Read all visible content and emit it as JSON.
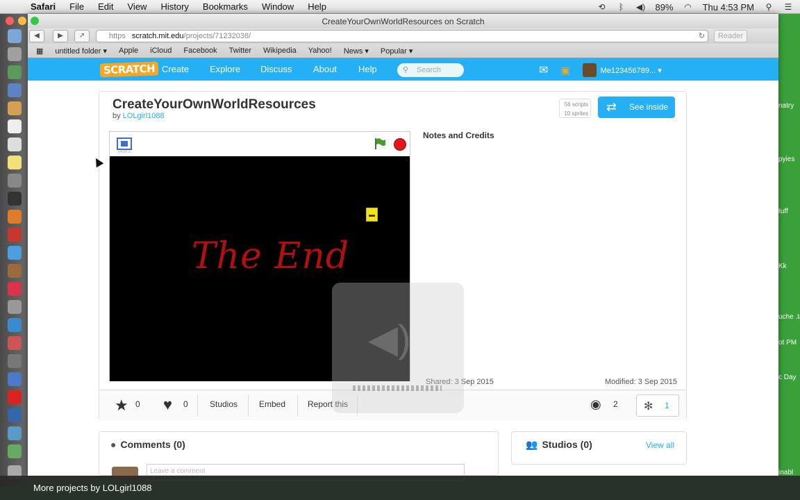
{
  "menubar": {
    "app": "Safari",
    "items": [
      "File",
      "Edit",
      "View",
      "History",
      "Bookmarks",
      "Window",
      "Help"
    ],
    "battery": "89%",
    "clock": "Thu 4:53 PM"
  },
  "window": {
    "title": "CreateYourOwnWorldResources on Scratch",
    "url_scheme": "https",
    "url_host": "scratch.mit.edu",
    "url_path": "/projects/71232038/",
    "reader": "Reader"
  },
  "bookmarks": [
    "untitled folder ▾",
    "Apple",
    "iCloud",
    "Facebook",
    "Twitter",
    "Wikipedia",
    "Yahoo!",
    "News ▾",
    "Popular ▾"
  ],
  "scratch_nav": {
    "logo": "SCRATCH",
    "links": [
      "Create",
      "Explore",
      "Discuss",
      "About",
      "Help"
    ],
    "search_placeholder": "Search",
    "user": "Me123456789... ▾"
  },
  "project": {
    "title": "CreateYourOwnWorldResources",
    "by": "by",
    "author": "LOLgirl1088",
    "scripts": "56 scripts",
    "sprites": "10 sprites",
    "see_inside": "See inside",
    "version": "v439.2",
    "stage_text": "The End",
    "notes_heading": "Notes and Credits",
    "shared": "Shared: 3 Sep 2015",
    "modified": "Modified: 3 Sep 2015"
  },
  "actions": {
    "stars": "0",
    "loves": "0",
    "studios": "Studios",
    "embed": "Embed",
    "report": "Report this",
    "views": "2",
    "remixes": "1"
  },
  "comments": {
    "heading": "Comments (0)",
    "placeholder": "Leave a comment"
  },
  "studios_panel": {
    "heading": "Studios (0)",
    "view_all": "View all"
  },
  "side_labels": [
    "natry",
    "pyies",
    "tuff",
    "Kk",
    "uche .talk",
    "ot PM",
    "c Day",
    "inabl"
  ],
  "bottom_bar": "More projects by LOLgirl1088",
  "colors": {
    "scratch_blue": "#25aff4",
    "stop_red": "#e0171d",
    "desktop_green": "#3aa03a"
  }
}
